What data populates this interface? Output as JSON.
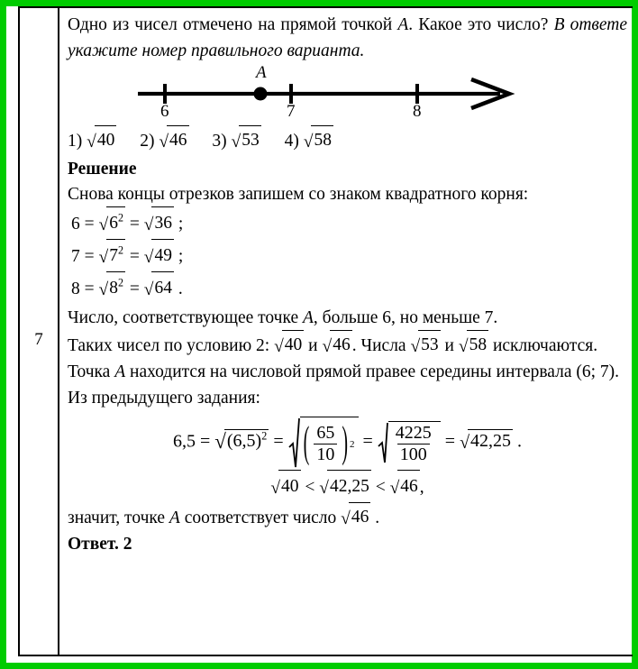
{
  "theme": {
    "frame_color": "#00cc00",
    "border_color": "#000000",
    "text_color": "#000000",
    "page_background": "#ffffff"
  },
  "task": {
    "number": "7"
  },
  "problem": {
    "statement_plain": "Одно из чисел отмечено на прямой точкой A . Какое это число?",
    "line1_part1": "Одно из чисел отмечено на прямой точкой",
    "line1_var": "A",
    "line1_part2": ". Какое это",
    "line2_part1": "число?",
    "line2_italic": "В ответе укажите номер правильного варианта."
  },
  "figure": {
    "kind": "number-line",
    "point_label": "A",
    "ticks": [
      {
        "label": "6",
        "value": 6
      },
      {
        "label": "7",
        "value": 7
      },
      {
        "label": "8",
        "value": 8
      }
    ],
    "point_position_value": 6.76,
    "axis_has_arrow": true
  },
  "options": [
    {
      "marker": "1)",
      "radicand": "40"
    },
    {
      "marker": "2)",
      "radicand": "46"
    },
    {
      "marker": "3)",
      "radicand": "53"
    },
    {
      "marker": "4)",
      "radicand": "58"
    }
  ],
  "solution": {
    "heading": "Решение",
    "intro": "Снова концы отрезков запишем со знаком квадратного корня:",
    "equations": [
      {
        "lhs": "6",
        "base": "6",
        "exp": "2",
        "result": "36",
        "terminator": ";"
      },
      {
        "lhs": "7",
        "base": "7",
        "exp": "2",
        "result": "49",
        "terminator": ";"
      },
      {
        "lhs": "8",
        "base": "8",
        "exp": "2",
        "result": "64",
        "terminator": "."
      }
    ],
    "para1_a": "Число, соответствующее точке",
    "para1_var": "A",
    "para1_b": ", больше 6, но меньше 7.",
    "para2_a": "Таких чисел по условию 2:",
    "para2_r1": "40",
    "para2_and": "и",
    "para2_r2": "46",
    "para2_b": ". Числа",
    "para2_r3": "53",
    "para2_and2": "и",
    "para2_r4": "58",
    "para2_c": "исключаются.",
    "para3_a": "Точка",
    "para3_var": "A",
    "para3_b": "находится на числовой прямой правее середины",
    "para3_c": "интервала",
    "para3_interval": "(6; 7)",
    "para3_d": ".",
    "prev_task_label": "Из предыдущего задания:",
    "main_formula": {
      "lhs": "6,5",
      "eq1_base": "(6,5)",
      "eq1_exp": "2",
      "frac_num": "65",
      "frac_den": "10",
      "frac_exp": "2",
      "frac2_num": "4225",
      "frac2_den": "100",
      "final_radicand": "42,25",
      "terminator": ".",
      "plain": "6,5 = √(6,5)² = √((65/10)²) = √(4225/100) = √42,25 ."
    },
    "inequality": {
      "left": "40",
      "middle": "42,25",
      "right": "46",
      "op": "<",
      "terminator": ",",
      "plain": "√40 < √42,25 < √46 ,"
    },
    "conclusion_a": "значит, точке",
    "conclusion_var": "A",
    "conclusion_b": "соответствует число",
    "conclusion_radicand": "46",
    "conclusion_c": ".",
    "answer_label": "Ответ.",
    "answer_value": "2"
  }
}
